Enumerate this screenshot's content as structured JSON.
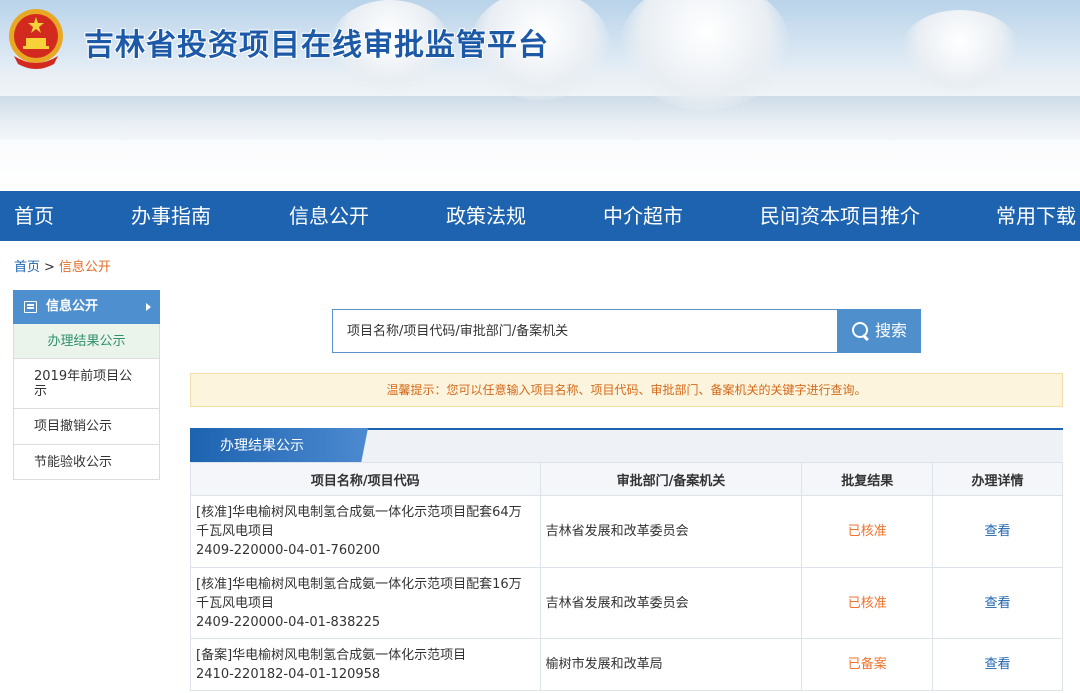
{
  "header": {
    "title": "吉林省投资项目在线审批监管平台"
  },
  "nav": {
    "items": [
      "首页",
      "办事指南",
      "信息公开",
      "政策法规",
      "中介超市",
      "民间资本项目推介",
      "常用下载"
    ]
  },
  "breadcrumb": {
    "home": "首页",
    "separator": ">",
    "current": "信息公开"
  },
  "sidebar": {
    "heading": "信息公开",
    "items": [
      "办理结果公示",
      "2019年前项目公示",
      "项目撤销公示",
      "节能验收公示"
    ]
  },
  "search": {
    "placeholder": "项目名称/项目代码/审批部门/备案机关",
    "button_label": "搜索"
  },
  "tip": {
    "text": "温馨提示：您可以任意输入项目名称、项目代码、审批部门、备案机关的关键字进行查询。"
  },
  "section": {
    "title": "办理结果公示"
  },
  "table": {
    "headers": [
      "项目名称/项目代码",
      "审批部门/备案机关",
      "批复结果",
      "办理详情"
    ],
    "rows": [
      {
        "name_line1": "[核准]华电榆树风电制氢合成氨一体化示范项目配套64万",
        "name_line2": "千瓦风电项目",
        "code": "2409-220000-04-01-760200",
        "dept": "吉林省发展和改革委员会",
        "result": "已核准",
        "detail": "查看"
      },
      {
        "name_line1": "[核准]华电榆树风电制氢合成氨一体化示范项目配套16万",
        "name_line2": "千瓦风电项目",
        "code": "2409-220000-04-01-838225",
        "dept": "吉林省发展和改革委员会",
        "result": "已核准",
        "detail": "查看"
      },
      {
        "name_line1": "[备案]华电榆树风电制氢合成氨一体化示范项目",
        "name_line2": "",
        "code": "2410-220182-04-01-120958",
        "dept": "榆树市发展和改革局",
        "result": "已备案",
        "detail": "查看"
      }
    ]
  },
  "colors": {
    "nav_bg": "#1d63b0",
    "accent_blue": "#4f8fcc",
    "result_orange": "#f0722b",
    "tip_text": "#d4691b"
  }
}
